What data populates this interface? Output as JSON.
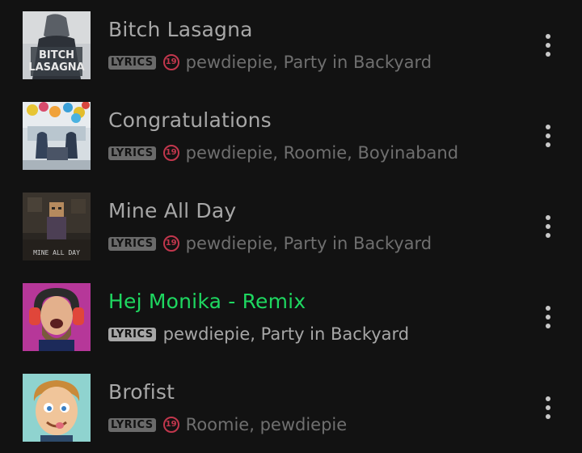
{
  "tracks": [
    {
      "title": "Bitch Lasagna",
      "lyrics_label": "LYRICS",
      "explicit": true,
      "explicit_label": "19",
      "artists": "pewdiepie, Party in Backyard",
      "art_text": [
        "BITCH",
        "LASAGNA"
      ],
      "active": false
    },
    {
      "title": "Congratulations",
      "lyrics_label": "LYRICS",
      "explicit": true,
      "explicit_label": "19",
      "artists": "pewdiepie, Roomie, Boyinaband",
      "active": false
    },
    {
      "title": "Mine All Day",
      "lyrics_label": "LYRICS",
      "explicit": true,
      "explicit_label": "19",
      "artists": "pewdiepie, Party in Backyard",
      "art_text": [
        "MINE ALL DAY"
      ],
      "active": false
    },
    {
      "title": "Hej Monika - Remix",
      "lyrics_label": "LYRICS",
      "explicit": false,
      "artists": "pewdiepie, Party in Backyard",
      "active": true
    },
    {
      "title": "Brofist",
      "lyrics_label": "LYRICS",
      "explicit": true,
      "explicit_label": "19",
      "artists": "Roomie, pewdiepie",
      "active": false
    }
  ],
  "colors": {
    "background": "#121212",
    "active_title": "#1ed760",
    "explicit": "#c2374d",
    "title": "#a7a7a7",
    "artists": "#6f6f6f"
  },
  "icons": {
    "more": "more-vertical-icon"
  }
}
